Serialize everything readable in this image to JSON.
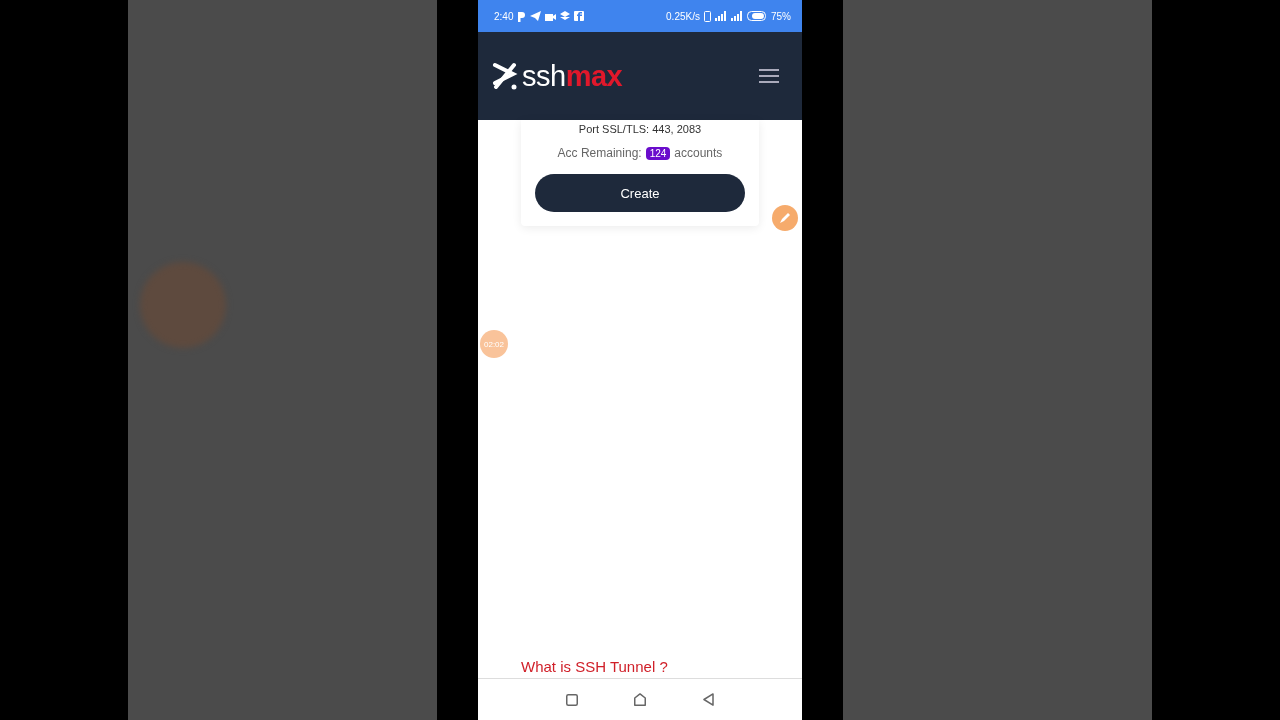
{
  "status_bar": {
    "time": "2:40",
    "net_speed": "0.25K/s",
    "battery": "75%"
  },
  "header": {
    "logo_left": "ssh",
    "logo_right": "max"
  },
  "card": {
    "port_line": "Port SSL/TLS: 443, 2083",
    "remaining_label": "Acc Remaining:",
    "remaining_count": "124",
    "remaining_unit": "accounts",
    "button": "Create"
  },
  "section_heading": "What is SSH Tunnel ?",
  "recording_timer": "02:02"
}
